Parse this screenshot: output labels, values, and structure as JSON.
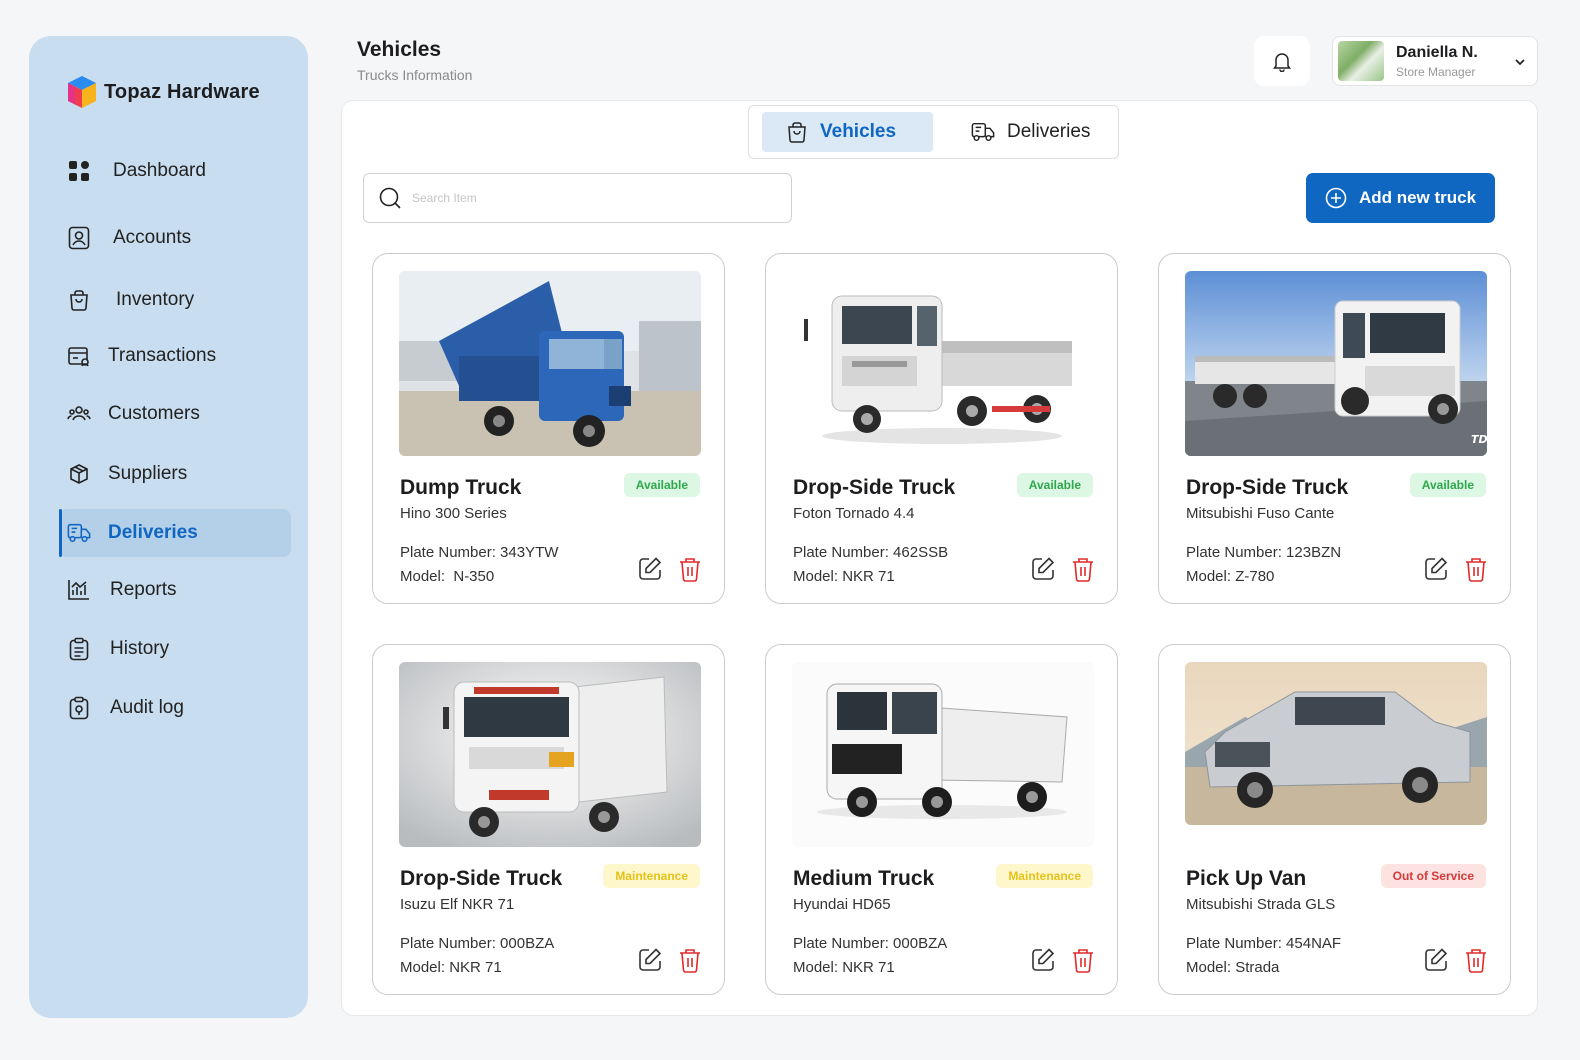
{
  "brand": {
    "name": "Topaz Hardware"
  },
  "sidebar": {
    "items": [
      {
        "label": "Dashboard",
        "icon": "grid-icon",
        "active": false
      },
      {
        "label": "Accounts",
        "icon": "user-card-icon",
        "active": false
      },
      {
        "label": "Inventory",
        "icon": "bag-icon",
        "active": false
      },
      {
        "label": "Transactions",
        "icon": "transactions-icon",
        "active": false
      },
      {
        "label": "Customers",
        "icon": "customers-icon",
        "active": false
      },
      {
        "label": "Suppliers",
        "icon": "box-icon",
        "active": false
      },
      {
        "label": "Deliveries",
        "icon": "truck-icon",
        "active": true
      },
      {
        "label": "Reports",
        "icon": "chart-icon",
        "active": false
      },
      {
        "label": "History",
        "icon": "clipboard-icon",
        "active": false
      },
      {
        "label": "Audit log",
        "icon": "audit-icon",
        "active": false
      }
    ]
  },
  "header": {
    "title": "Vehicles",
    "subtitle": "Trucks Information"
  },
  "user": {
    "name": "Daniella N.",
    "role": "Store Manager"
  },
  "tabs": {
    "vehicles": "Vehicles",
    "deliveries": "Deliveries"
  },
  "search": {
    "placeholder": "Search Item",
    "value": ""
  },
  "actions": {
    "add_truck": "Add new truck"
  },
  "labels": {
    "plate_prefix": "Plate Number: ",
    "model_prefix": "Model: "
  },
  "colors": {
    "accent": "#0f67c2",
    "sidebar": "#c8ddef",
    "danger": "#e02b2b"
  },
  "vehicles": [
    {
      "title": "Dump Truck",
      "subtitle": "Hino 300 Series",
      "status": "Available",
      "status_kind": "available",
      "plate": "Plate Number: 343YTW",
      "model": "Model:  N-350",
      "image": "blue-dump-truck"
    },
    {
      "title": "Drop-Side Truck",
      "subtitle": "Foton Tornado 4.4",
      "status": "Available",
      "status_kind": "available",
      "plate": "Plate Number: 462SSB",
      "model": "Model: NKR 71",
      "image": "white-drop-side-truck"
    },
    {
      "title": "Drop-Side Truck",
      "subtitle": "Mitsubishi Fuso Cante",
      "status": "Available",
      "status_kind": "available",
      "plate": "Plate Number: 123BZN",
      "model": "Model: Z-780",
      "image": "white-large-truck"
    },
    {
      "title": "Drop-Side Truck",
      "subtitle": "Isuzu Elf NKR 71",
      "status": "Maintenance",
      "status_kind": "maintenance",
      "plate": "Plate Number: 000BZA",
      "model": "Model: NKR 71",
      "image": "white-dump-truck"
    },
    {
      "title": "Medium Truck",
      "subtitle": "Hyundai HD65",
      "status": "Maintenance",
      "status_kind": "maintenance",
      "plate": "Plate Number: 000BZA",
      "model": "Model: NKR 71",
      "image": "white-medium-truck"
    },
    {
      "title": "Pick Up Van",
      "subtitle": "Mitsubishi Strada GLS",
      "status": "Out of Service",
      "status_kind": "out",
      "plate": "Plate Number: 454NAF",
      "model": "Model: Strada",
      "image": "silver-pickup"
    }
  ]
}
